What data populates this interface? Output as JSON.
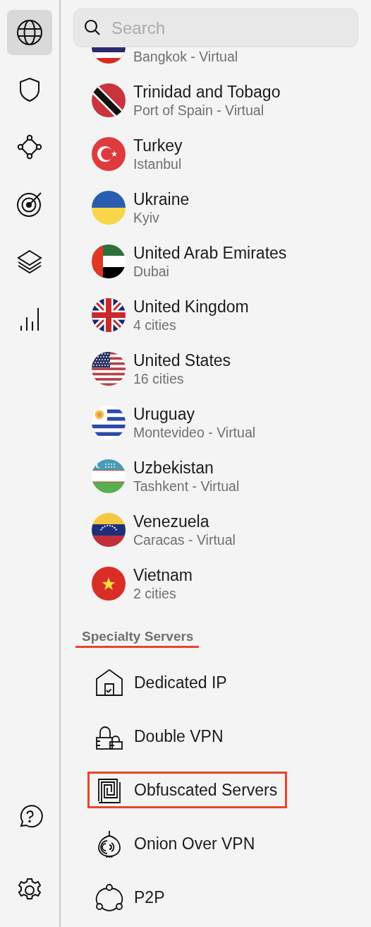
{
  "rail": [
    {
      "kind": "globe",
      "selected": true
    },
    {
      "kind": "shield",
      "selected": false
    },
    {
      "kind": "nodes",
      "selected": false
    },
    {
      "kind": "target",
      "selected": false
    },
    {
      "kind": "layers",
      "selected": false
    },
    {
      "kind": "bars",
      "selected": false
    }
  ],
  "rail_bottom": [
    {
      "kind": "help"
    },
    {
      "kind": "settings"
    }
  ],
  "search": {
    "placeholder": "Search"
  },
  "countries": [
    {
      "kind": "th",
      "subtitle": "Bangkok - Virtual"
    },
    {
      "kind": "tt",
      "name": "Trinidad and Tobago",
      "subtitle": "Port of Spain - Virtual"
    },
    {
      "kind": "tr",
      "name": "Turkey",
      "subtitle": "Istanbul"
    },
    {
      "kind": "ua",
      "name": "Ukraine",
      "subtitle": "Kyiv"
    },
    {
      "kind": "ae",
      "name": "United Arab Emirates",
      "subtitle": "Dubai"
    },
    {
      "kind": "gb",
      "name": "United Kingdom",
      "subtitle": "4 cities"
    },
    {
      "kind": "us",
      "name": "United States",
      "subtitle": "16 cities"
    },
    {
      "kind": "uy",
      "name": "Uruguay",
      "subtitle": "Montevideo - Virtual"
    },
    {
      "kind": "uz",
      "name": "Uzbekistan",
      "subtitle": "Tashkent - Virtual"
    },
    {
      "kind": "ve",
      "name": "Venezuela",
      "subtitle": "Caracas - Virtual"
    },
    {
      "kind": "vn",
      "name": "Vietnam",
      "subtitle": "2 cities"
    }
  ],
  "specialty": {
    "title": "Specialty Servers",
    "underlined": true,
    "items": [
      {
        "kind": "house",
        "label": "Dedicated IP",
        "highlighted": false
      },
      {
        "kind": "locks",
        "label": "Double VPN",
        "highlighted": false
      },
      {
        "kind": "maze",
        "label": "Obfuscated Servers",
        "highlighted": true
      },
      {
        "kind": "onion",
        "label": "Onion Over VPN",
        "highlighted": false
      },
      {
        "kind": "triad",
        "label": "P2P",
        "highlighted": false
      }
    ]
  }
}
